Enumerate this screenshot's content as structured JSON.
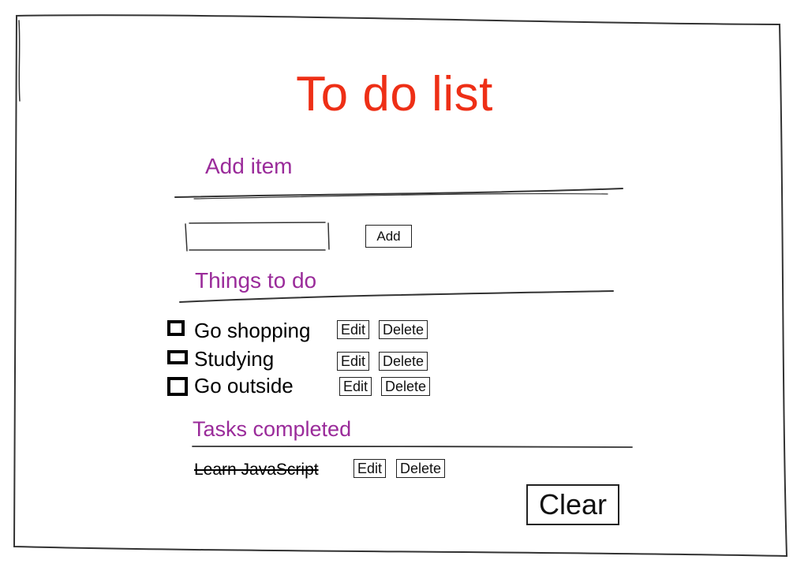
{
  "app": {
    "title": "To do list"
  },
  "add_section": {
    "heading": "Add item",
    "input_value": "",
    "input_placeholder": "",
    "add_label": "Add"
  },
  "todo_section": {
    "heading": "Things to do",
    "items": [
      {
        "label": "Go shopping",
        "checked": false,
        "edit_label": "Edit",
        "delete_label": "Delete"
      },
      {
        "label": "Studying",
        "checked": false,
        "edit_label": "Edit",
        "delete_label": "Delete"
      },
      {
        "label": "Go outside",
        "checked": false,
        "edit_label": "Edit",
        "delete_label": "Delete"
      }
    ]
  },
  "completed_section": {
    "heading": "Tasks completed",
    "items": [
      {
        "label": "Learn JavaScript",
        "edit_label": "Edit",
        "delete_label": "Delete"
      }
    ]
  },
  "footer": {
    "clear_label": "Clear"
  },
  "colors": {
    "title": "#ee2f16",
    "heading": "#9a2b9a",
    "ink": "#222222"
  }
}
